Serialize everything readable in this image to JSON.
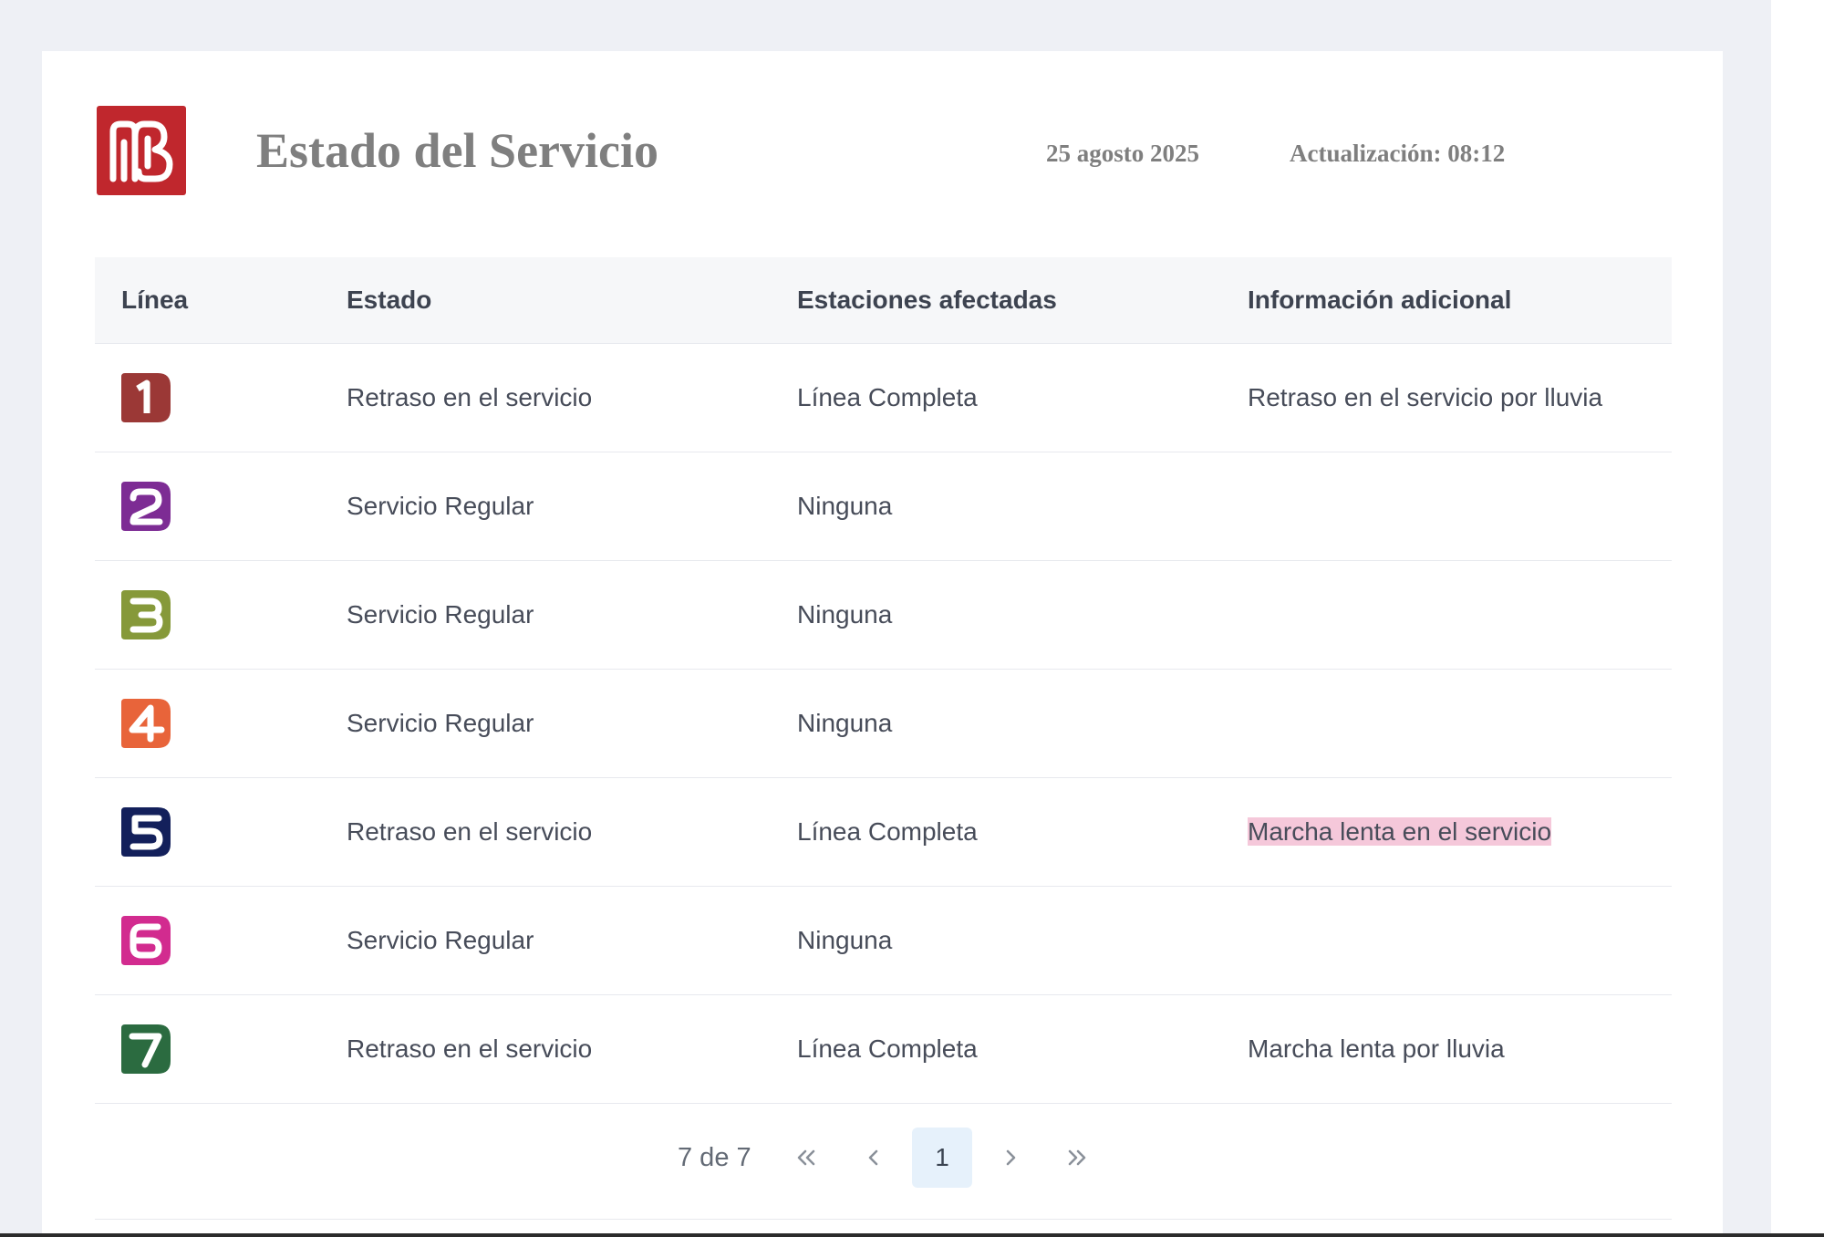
{
  "header": {
    "title": "Estado del Servicio",
    "date": "25 agosto 2025",
    "update": "Actualización: 08:12",
    "logo_icon": "metro-logo-icon",
    "logo_color": "#c0272d"
  },
  "table": {
    "columns": [
      "Línea",
      "Estado",
      "Estaciones afectadas",
      "Información adicional"
    ],
    "rows": [
      {
        "line": "1",
        "color": "#9b3836",
        "icon": "line-1-icon",
        "status": "Retraso en el servicio",
        "stations": "Línea Completa",
        "info": "Retraso en el servicio por lluvia"
      },
      {
        "line": "2",
        "color": "#7d2c94",
        "icon": "line-2-icon",
        "status": "Servicio Regular",
        "stations": "Ninguna",
        "info": ""
      },
      {
        "line": "3",
        "color": "#86993a",
        "icon": "line-3-icon",
        "status": "Servicio Regular",
        "stations": "Ninguna",
        "info": ""
      },
      {
        "line": "4",
        "color": "#e8643a",
        "icon": "line-4-icon",
        "status": "Servicio Regular",
        "stations": "Ninguna",
        "info": ""
      },
      {
        "line": "5",
        "color": "#13205b",
        "icon": "line-5-icon",
        "status": "Retraso en el servicio",
        "stations": "Línea Completa",
        "info": "Marcha lenta en el servicio",
        "info_highlight": "#f5c8da"
      },
      {
        "line": "6",
        "color": "#d22b8f",
        "icon": "line-6-icon",
        "status": "Servicio Regular",
        "stations": "Ninguna",
        "info": ""
      },
      {
        "line": "7",
        "color": "#2b6b40",
        "icon": "line-7-icon",
        "status": "Retraso en el servicio",
        "stations": "Línea Completa",
        "info": "Marcha lenta por lluvia"
      }
    ]
  },
  "pagination": {
    "count": "7 de 7",
    "current": "1",
    "first_icon": "double-chevron-left-icon",
    "prev_icon": "chevron-left-icon",
    "next_icon": "chevron-right-icon",
    "last_icon": "double-chevron-right-icon"
  }
}
